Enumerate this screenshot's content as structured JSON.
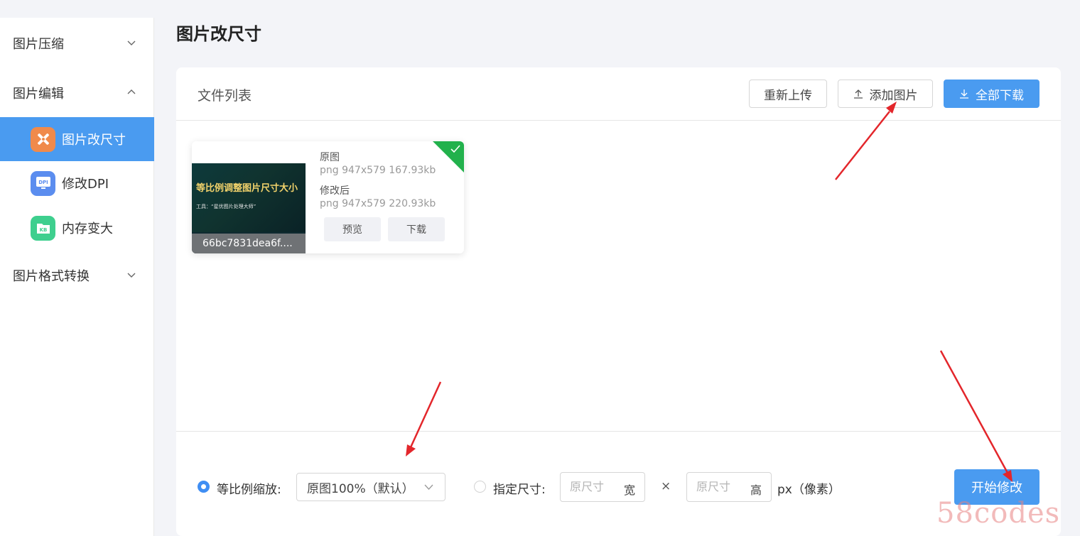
{
  "page_title": "图片改尺寸",
  "sidebar": {
    "groups": [
      {
        "label": "图片压缩",
        "expanded": false
      },
      {
        "label": "图片编辑",
        "expanded": true
      },
      {
        "label": "图片格式转换",
        "expanded": false
      }
    ],
    "edit_items": [
      {
        "label": "图片改尺寸",
        "active": true,
        "icon": "resize-tools-icon",
        "icon_color": "#f08a4b"
      },
      {
        "label": "修改DPI",
        "active": false,
        "icon": "dpi-monitor-icon",
        "icon_text": "DPI",
        "icon_color": "#5b8def"
      },
      {
        "label": "内存变大",
        "active": false,
        "icon": "kb-folder-icon",
        "icon_text": "KB",
        "icon_color": "#3ecf8e"
      }
    ]
  },
  "file_panel": {
    "title": "文件列表",
    "buttons": {
      "reupload": "重新上传",
      "add_image": "添加图片",
      "download_all": "全部下载"
    }
  },
  "file_card": {
    "thumbnail_title": "等比例调整图片尺寸大小",
    "thumbnail_subtitle": "工具：“星优图片处理大师”",
    "file_name": "66bc7831dea6f....",
    "original_label": "原图",
    "original_info": "png  947x579  167.93kb",
    "modified_label": "修改后",
    "modified_info": "png  947x579  220.93kb",
    "preview_label": "预览",
    "download_label": "下载",
    "status": "done"
  },
  "controls": {
    "proportional_label": "等比例缩放:",
    "proportional_selected": true,
    "scale_value": "原图100%（默认）",
    "specify_label": "指定尺寸:",
    "specify_selected": false,
    "width_placeholder": "原尺寸",
    "width_suffix": "宽",
    "times_symbol": "×",
    "height_placeholder": "原尺寸",
    "height_suffix": "高",
    "unit_label": "px（像素）",
    "start_label": "开始修改"
  },
  "watermark": "58codes",
  "colors": {
    "accent": "#4a9bf0",
    "success_badge": "#22b14c",
    "annotation_arrow": "#e3262b"
  }
}
